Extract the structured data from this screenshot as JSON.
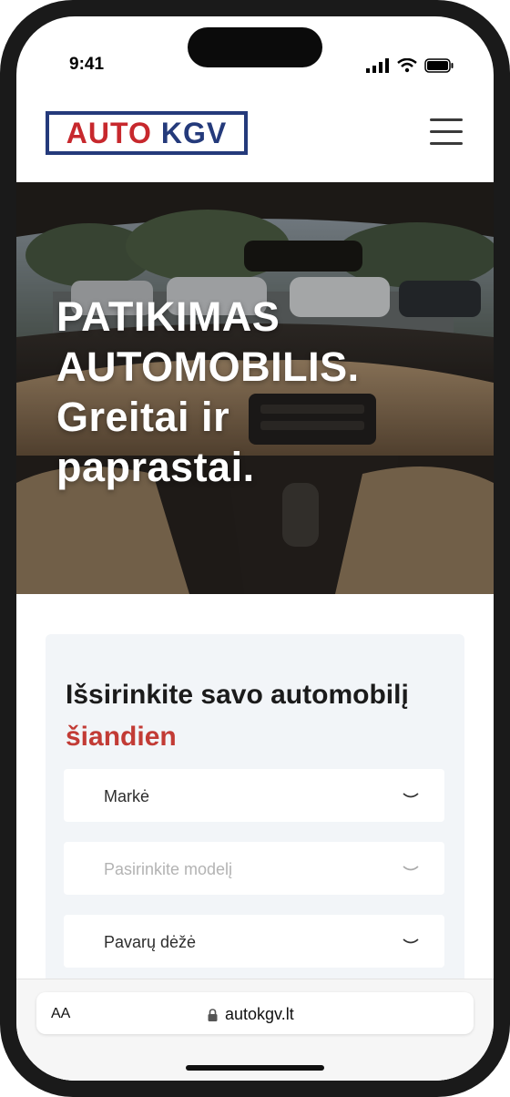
{
  "status_bar": {
    "time": "9:41"
  },
  "header": {
    "logo_part1": "AUTO",
    "logo_part2": "KGV"
  },
  "hero": {
    "line1": "PATIKIMAS",
    "line2": "AUTOMOBILIS.",
    "line3": "Greitai ir",
    "line4": "paprastai."
  },
  "search": {
    "title": "Išsirinkite savo automobilį",
    "title_highlight": "šiandien",
    "fields": [
      {
        "label": "Markė"
      },
      {
        "label": "Pasirinkite modelį"
      },
      {
        "label": "Pavarų dėžė"
      }
    ]
  },
  "browser": {
    "aa_label": "AA",
    "url": "autokgv.lt"
  },
  "colors": {
    "brand_red": "#c7282d",
    "brand_blue": "#243a7b",
    "highlight": "#c23b35"
  }
}
